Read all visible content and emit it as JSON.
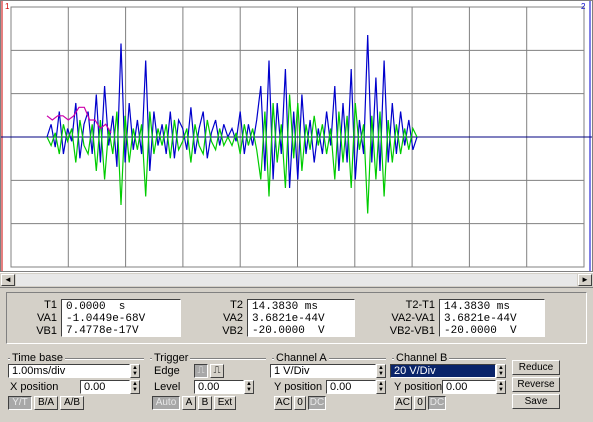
{
  "markers": {
    "t1": "1",
    "t2": "2"
  },
  "scrollbar": {
    "left_arrow": "◄",
    "right_arrow": "►"
  },
  "readouts": {
    "t1": {
      "labels": [
        "T1",
        "VA1",
        "VB1"
      ],
      "values": [
        "0.0000  s",
        "-1.0449e-68V",
        "7.4778e-17V"
      ]
    },
    "t2": {
      "labels": [
        "T2",
        "VA2",
        "VB2"
      ],
      "values": [
        "14.3830 ms",
        "3.6821e-44V",
        "-20.0000  V"
      ]
    },
    "delta": {
      "labels": [
        "T2-T1",
        "VA2-VA1",
        "VB2-VB1"
      ],
      "values": [
        "14.3830 ms",
        "3.6821e-44V",
        "-20.0000  V"
      ]
    }
  },
  "timebase": {
    "title": "Time base",
    "value": "1.00ms/div",
    "xpos_label": "X position",
    "xpos": "0.00",
    "modes": [
      "Y/T",
      "B/A",
      "A/B"
    ]
  },
  "trigger": {
    "title": "Trigger",
    "edge_label": "Edge",
    "level_label": "Level",
    "level": "0.00",
    "sources": [
      "Auto",
      "A",
      "B",
      "Ext"
    ]
  },
  "channel_a": {
    "title": "Channel A",
    "value": "1  V/Div",
    "ypos_label": "Y position",
    "ypos": "0.00",
    "coupling": [
      "AC",
      "0",
      "DC"
    ]
  },
  "channel_b": {
    "title": "Channel B",
    "value": "20  V/Div",
    "ypos_label": "Y position",
    "ypos": "0.00",
    "coupling": [
      "AC",
      "0",
      "DC"
    ]
  },
  "buttons": {
    "reduce": "Reduce",
    "reverse": "Reverse",
    "save": "Save"
  },
  "colors": {
    "channel_a": "#00cc00",
    "channel_b": "#0000cc",
    "reference": "#cc00aa",
    "grid": "#808080",
    "cursor": "#cc0000"
  },
  "chart_data": {
    "type": "line",
    "grid": true,
    "series": [
      {
        "color": "#0000cc",
        "values": [
          0,
          0.15,
          -0.12,
          0.3,
          -0.2,
          0.1,
          -0.05,
          0.4,
          -0.25,
          0.15,
          0.3,
          -0.2,
          0.5,
          -0.3,
          0.6,
          -0.1,
          0.25,
          -0.35,
          1.1,
          -0.3,
          0.4,
          -0.15,
          0.2,
          -0.2,
          0.9,
          -0.4,
          0.3,
          -0.1,
          0.15,
          -0.2,
          0.3,
          -0.25,
          0.2,
          0.1,
          -0.15,
          0.35,
          -0.2,
          0.1,
          0.3,
          -0.25,
          0.05,
          0.2,
          -0.1,
          0.15,
          0,
          0.1,
          -0.05,
          0.3,
          -0.2,
          0.15,
          -0.1,
          0.2,
          0.6,
          -0.4,
          0.9,
          -0.5,
          0.4,
          -0.2,
          0.8,
          -0.6,
          0.3,
          -0.5,
          0.5,
          -0.2,
          0.2,
          -0.3,
          0.1,
          -0.2,
          0.3,
          -0.1,
          0.6,
          -0.4,
          0.4,
          -0.3,
          0.8,
          -0.5,
          0.2,
          -0.2,
          1.2,
          -0.3,
          0.7,
          -0.4,
          0.9,
          -0.3,
          0.4,
          -0.2,
          0.3,
          -0.1,
          0.2,
          -0.15,
          0
        ]
      },
      {
        "color": "#00cc00",
        "values": [
          0,
          -0.1,
          0.05,
          -0.2,
          0.15,
          -0.05,
          0.1,
          -0.3,
          0.2,
          -0.1,
          -0.2,
          0.15,
          -0.4,
          0.2,
          -0.5,
          0.1,
          -0.2,
          0.3,
          -0.8,
          0.25,
          -0.3,
          0.1,
          -0.15,
          0.15,
          -0.7,
          0.3,
          -0.2,
          0.1,
          -0.1,
          0.15,
          -0.25,
          0.2,
          -0.15,
          -0.05,
          0.1,
          -0.3,
          0.15,
          -0.1,
          -0.2,
          0.2,
          -0.05,
          -0.15,
          0.1,
          -0.1,
          0,
          -0.1,
          0.05,
          -0.2,
          0.15,
          -0.1,
          0.1,
          -0.15,
          -0.5,
          0.3,
          -0.7,
          0.4,
          -0.3,
          0.15,
          -0.6,
          0.5,
          -0.25,
          0.4,
          -0.4,
          0.15,
          -0.15,
          0.25,
          -0.1,
          0.15,
          -0.2,
          0.1,
          -0.5,
          0.3,
          -0.3,
          0.25,
          -0.6,
          0.4,
          -0.15,
          0.15,
          -0.9,
          0.25,
          -0.5,
          0.3,
          -0.7,
          0.2,
          -0.3,
          0.15,
          -0.2,
          0.1,
          -0.15,
          0.1,
          0
        ]
      },
      {
        "color": "#cc00aa",
        "values": [
          0.25,
          0.2,
          0.25,
          0.25,
          0.2,
          0.25,
          0.35,
          0.35,
          0.2,
          0.2,
          0.1,
          0.15,
          0.05
        ]
      }
    ]
  }
}
